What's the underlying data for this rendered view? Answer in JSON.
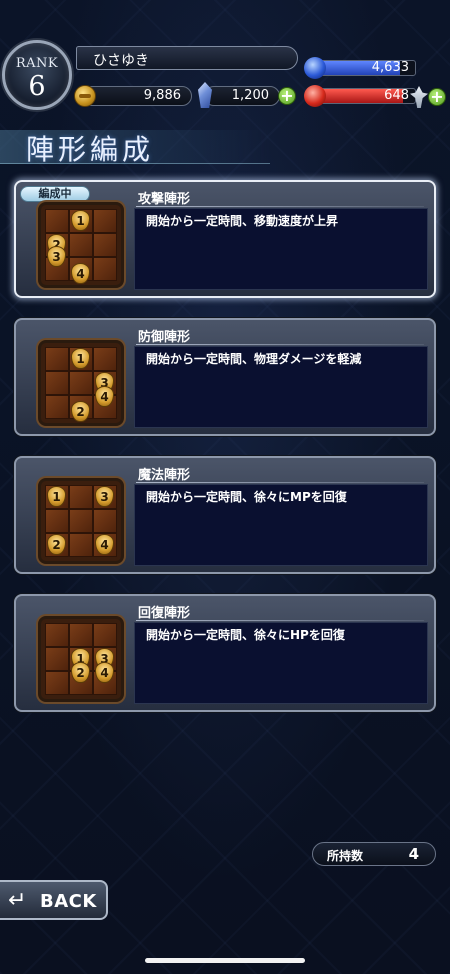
{
  "header": {
    "rank_label": "RANK",
    "rank_value": "6",
    "player_name": "ひさゆき",
    "gil": "9,886",
    "crystals": "1,200",
    "mp_value": "4,633",
    "hp_value": "648",
    "mp_fill_fraction": 0.85,
    "hp_fill_fraction": 0.88
  },
  "page": {
    "title": "陣形編成"
  },
  "formations": [
    {
      "name": "攻撃陣形",
      "description": "開始から一定時間、移動速度が上昇",
      "active": true,
      "active_label": "編成中",
      "slots": [
        {
          "n": "1",
          "r": 0,
          "c": 1
        },
        {
          "n": "2",
          "r": 1,
          "c": 0
        },
        {
          "n": "3",
          "r": 1.5,
          "c": 0
        },
        {
          "n": "4",
          "r": 2.2,
          "c": 1
        }
      ]
    },
    {
      "name": "防御陣形",
      "description": "開始から一定時間、物理ダメージを軽減",
      "active": false,
      "slots": [
        {
          "n": "1",
          "r": 0,
          "c": 1
        },
        {
          "n": "3",
          "r": 1,
          "c": 2
        },
        {
          "n": "4",
          "r": 1.6,
          "c": 2
        },
        {
          "n": "2",
          "r": 2.2,
          "c": 1
        }
      ]
    },
    {
      "name": "魔法陣形",
      "description": "開始から一定時間、徐々にMPを回復",
      "active": false,
      "slots": [
        {
          "n": "1",
          "r": 0,
          "c": 0
        },
        {
          "n": "3",
          "r": 0,
          "c": 2
        },
        {
          "n": "2",
          "r": 2,
          "c": 0
        },
        {
          "n": "4",
          "r": 2,
          "c": 2
        }
      ]
    },
    {
      "name": "回復陣形",
      "description": "開始から一定時間、徐々にHPを回復",
      "active": false,
      "slots": [
        {
          "n": "1",
          "r": 1,
          "c": 1
        },
        {
          "n": "3",
          "r": 1,
          "c": 2
        },
        {
          "n": "2",
          "r": 1.6,
          "c": 1
        },
        {
          "n": "4",
          "r": 1.6,
          "c": 2
        }
      ]
    }
  ],
  "footer": {
    "owned_label": "所持数",
    "owned_value": "4",
    "back_label": "BACK",
    "back_icon": "back-arrow-icon"
  },
  "colors": {
    "mp_bar": "#3b66e0",
    "hp_bar": "#d03030",
    "active_border": "#e9eef6",
    "panel_bg": "#0a1030"
  }
}
